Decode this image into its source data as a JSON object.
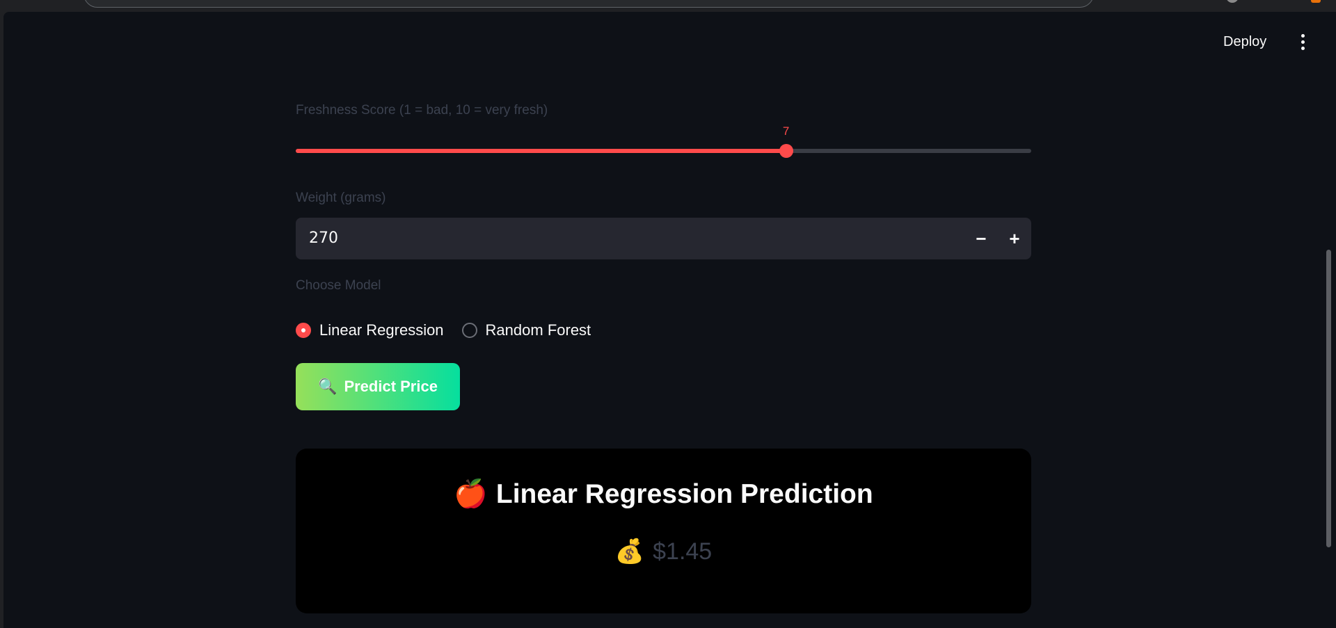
{
  "header": {
    "deploy_label": "Deploy",
    "menu_icon": "more-vertical-icon"
  },
  "freshness": {
    "label": "Freshness Score (1 = bad, 10 = very fresh)",
    "value": "7",
    "min": 1,
    "max": 10
  },
  "weight": {
    "label": "Weight (grams)",
    "value": "270",
    "decrement_label": "−",
    "increment_label": "+"
  },
  "model": {
    "label": "Choose Model",
    "options": [
      "Linear Regression",
      "Random Forest"
    ],
    "selected": "Linear Regression"
  },
  "predict_button": {
    "icon": "🔍",
    "label": "Predict Price"
  },
  "result": {
    "title_icon": "🍎",
    "title": "Linear Regression Prediction",
    "price_icon": "💰",
    "price": "$1.45"
  },
  "colors": {
    "accent": "#ff4b4b",
    "background": "#0e1117",
    "input_bg": "#262730",
    "button_gradient_start": "#96e05a",
    "button_gradient_end": "#06df9e"
  }
}
